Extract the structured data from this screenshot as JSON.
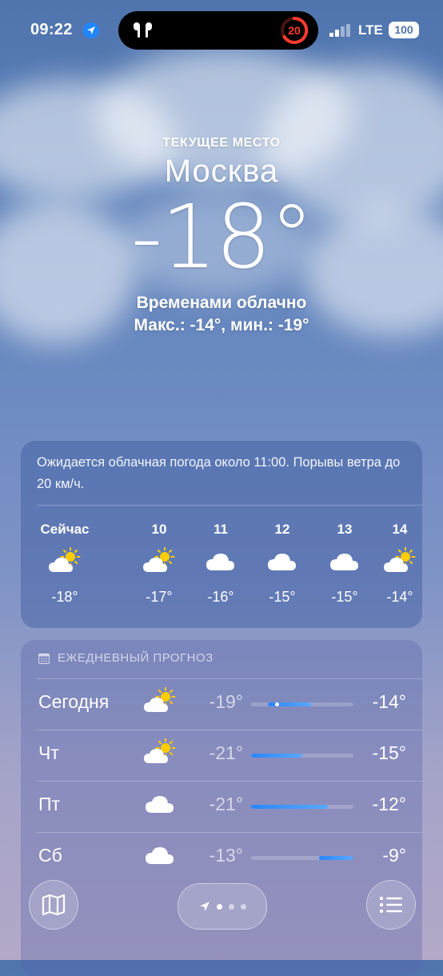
{
  "status_bar": {
    "time": "09:22",
    "network": "LTE",
    "battery": "100",
    "activity_ring_value": "20"
  },
  "header": {
    "subtitle": "ТЕКУЩЕЕ МЕСТО",
    "city": "Москва",
    "temperature": "-18°",
    "condition": "Временами облачно",
    "hilo": "Макс.: -14°, мин.: -19°"
  },
  "hourly": {
    "summary": "Ожидается облачная погода около 11:00. Порывы ветра до 20 км/ч.",
    "items": [
      {
        "label": "Сейчас",
        "icon": "partly-sunny-icon",
        "temp": "-18°"
      },
      {
        "label": "10",
        "icon": "partly-sunny-icon",
        "temp": "-17°"
      },
      {
        "label": "11",
        "icon": "cloud-icon",
        "temp": "-16°"
      },
      {
        "label": "12",
        "icon": "cloud-icon",
        "temp": "-15°"
      },
      {
        "label": "13",
        "icon": "cloud-icon",
        "temp": "-15°"
      },
      {
        "label": "14",
        "icon": "partly-sunny-icon",
        "temp": "-14°"
      }
    ]
  },
  "daily": {
    "title": "ЕЖЕДНЕВНЫЙ ПРОГНОЗ",
    "range_min": -21,
    "range_max": -9,
    "days": [
      {
        "day": "Сегодня",
        "icon": "partly-sunny-icon",
        "min": "-19°",
        "max": "-14°",
        "min_val": -19,
        "max_val": -14,
        "current_val": -18
      },
      {
        "day": "Чт",
        "icon": "partly-sunny-icon",
        "min": "-21°",
        "max": "-15°",
        "min_val": -21,
        "max_val": -15
      },
      {
        "day": "Пт",
        "icon": "cloud-icon",
        "min": "-21°",
        "max": "-12°",
        "min_val": -21,
        "max_val": -12
      },
      {
        "day": "Сб",
        "icon": "cloud-icon",
        "min": "-13°",
        "max": "-9°",
        "min_val": -13,
        "max_val": -9
      }
    ]
  },
  "colors": {
    "bar_start": "#2a86ff",
    "bar_end": "#5aa8ff",
    "activity_ring": "#ff3b30"
  }
}
